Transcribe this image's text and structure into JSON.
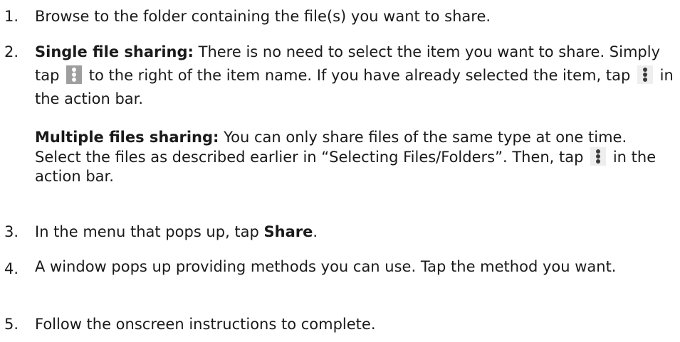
{
  "steps": [
    {
      "number": "1.",
      "text": "Browse to the folder containing the file(s) you want to share."
    },
    {
      "number": "2.",
      "single_label": "Single file sharing:",
      "single_text_a": " There is no need to select the item you want to share. Simply tap ",
      "single_text_b": " to the right of the item name. If you have already selected the item, tap ",
      "single_text_c": " in the action bar.",
      "multi_label": "Multiple files sharing:",
      "multi_text_a": " You can only share files of the same type at one time. Select the files as described earlier in “Selecting Files/Folders”. Then, tap ",
      "multi_text_b": " in the action bar."
    },
    {
      "number": "3.",
      "text_a": "In the menu that pops up, tap ",
      "bold": "Share",
      "text_b": "."
    },
    {
      "number": "4.",
      "text": "A window pops up providing methods you can use. Tap the method you want."
    },
    {
      "number": "5.",
      "text": "Follow the onscreen instructions to complete."
    }
  ],
  "icons": {
    "more_menu": "more-vertical-icon",
    "colors": {
      "dark_bg": "#9e9e9e",
      "light_bg": "#eeeeee"
    }
  }
}
